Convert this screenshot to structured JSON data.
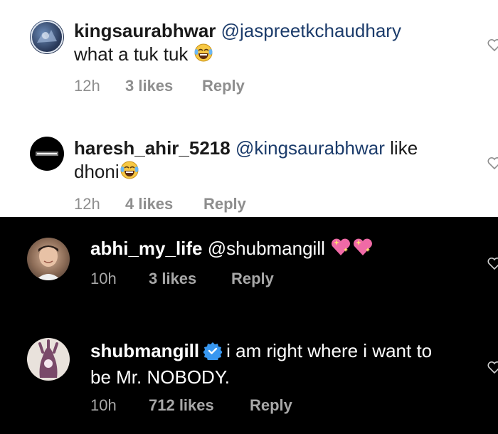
{
  "comments": [
    {
      "username": "kingsaurabhwar",
      "mention": "@jaspreetkchaudhary",
      "line2": "what a tuk tuk",
      "emoji": "laughing-tears-emoji",
      "time": "12h",
      "likes": "3 likes",
      "reply": "Reply"
    },
    {
      "username": "haresh_ahir_5218",
      "mention": "@kingsaurabhwar",
      "after_mention": "like",
      "line2": "dhoni",
      "emoji": "laughing-tears-emoji",
      "time": "12h",
      "likes": "4 likes",
      "reply": "Reply"
    },
    {
      "username": "abhi_my_life",
      "mention": "@shubmangill",
      "emoji": "sparkling-heart-emoji",
      "time": "10h",
      "likes": "3 likes",
      "reply": "Reply"
    },
    {
      "username": "shubmangill",
      "verified_icon": "verified-badge-icon",
      "text": "i am right where i want to",
      "line2": "be Mr. NOBODY.",
      "time": "10h",
      "likes": "712 likes",
      "reply": "Reply"
    }
  ],
  "icons": {
    "like": "heart-outline-icon"
  },
  "colors": {
    "mention": "#1c3c6b",
    "verified": "#3897f0",
    "meta_light": "#8e8e8e",
    "meta_dark": "#a8a8a8"
  }
}
